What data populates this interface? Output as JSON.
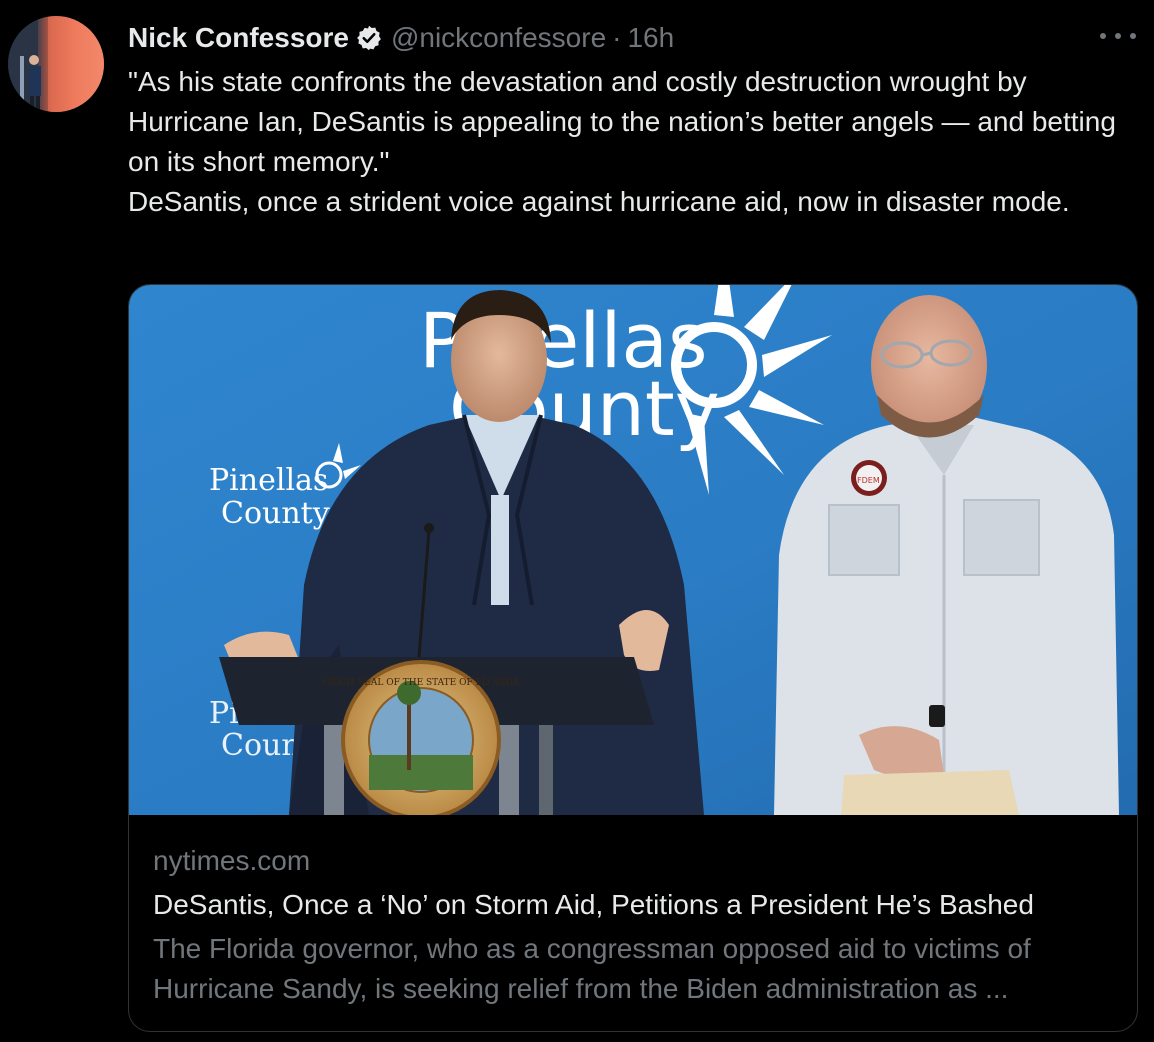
{
  "author": {
    "name": "Nick Confessore",
    "handle": "@nickconfessore",
    "separator": "·",
    "time": "16h",
    "verified_icon": "verified-badge-icon"
  },
  "menu_icon": "more-horizontal-icon",
  "tweet": {
    "lines": [
      "\"As his state confronts the devastation and costly destruction wrought by Hurricane Ian, DeSantis is appealing to the nation’s better angels — and betting on its short memory.\"",
      "DeSantis, once a strident voice against hurricane aid, now in disaster mode."
    ]
  },
  "card": {
    "domain": "nytimes.com",
    "headline": "DeSantis, Once a ‘No’ on Storm Aid, Petitions a President He’s Bashed",
    "description": "The Florida governor, who as a congressman opposed aid to victims of Hurricane Sandy, is seeking relief from the Biden administration as ...",
    "image": {
      "backdrop_text_large_1": "Pinellas",
      "backdrop_text_large_2": "County",
      "backdrop_text_small_1": "Pinellas",
      "backdrop_text_small_2": "County",
      "seal_text": "GREAT SEAL OF THE STATE OF FLORIDA",
      "patch_text": "FDEM"
    }
  },
  "colors": {
    "background": "#000000",
    "text_primary": "#e7e9ea",
    "text_secondary": "#71767b",
    "border": "#2f3336",
    "verified": "#e7e9ea",
    "backdrop_blue": "#2c7fc9"
  }
}
